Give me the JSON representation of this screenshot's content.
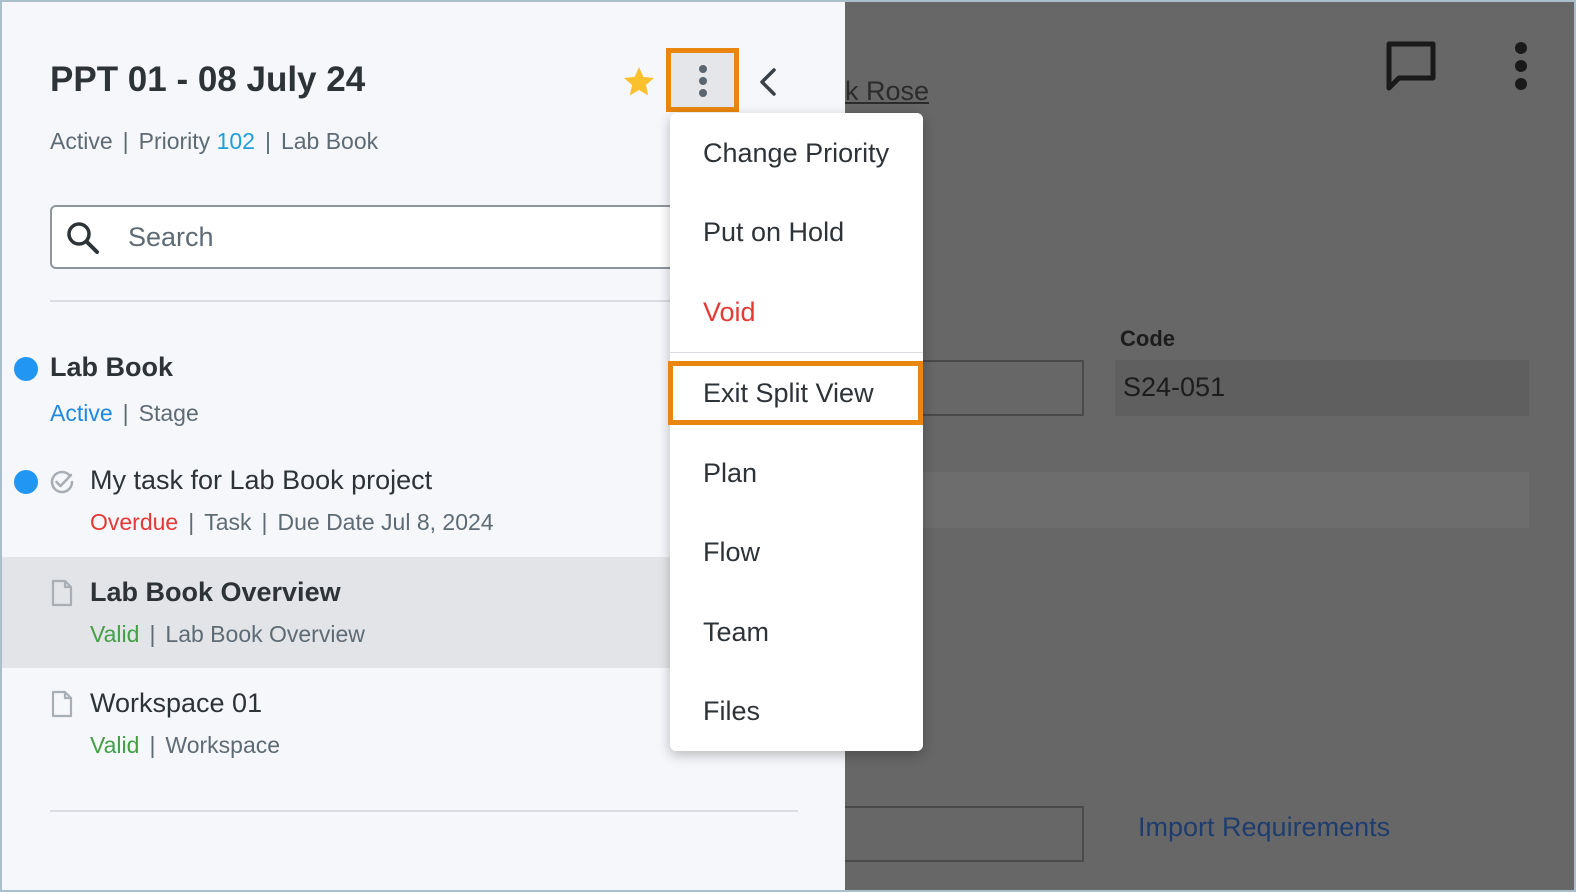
{
  "header": {
    "title": "PPT 01 - 08 July 24",
    "status": "Active",
    "priority_label": "Priority",
    "priority_value": "102",
    "type": "Lab Book"
  },
  "search": {
    "placeholder": "Search"
  },
  "items": [
    {
      "title": "Lab Book",
      "status": "Active",
      "kind": "Stage",
      "status_color": "#1e88e5"
    },
    {
      "title": "My task for Lab Book project",
      "status": "Overdue",
      "kind": "Task",
      "due": "Due Date Jul 8, 2024",
      "status_color": "#e53935"
    },
    {
      "title": "Lab Book Overview",
      "status": "Valid",
      "kind": "Lab Book Overview",
      "status_color": "#43a047"
    },
    {
      "title": "Workspace 01",
      "status": "Valid",
      "kind": "Workspace",
      "status_color": "#43a047"
    }
  ],
  "menu": {
    "items": [
      "Change Priority",
      "Put on Hold",
      "Void",
      "Exit Split View",
      "Plan",
      "Flow",
      "Team",
      "Files"
    ]
  },
  "right": {
    "link_text": "k Rose",
    "code_label": "Code",
    "code_value": "S24-051",
    "import_label": "Import Requirements"
  },
  "colors": {
    "accent": "#1e9fd6",
    "highlight": "#e8860f",
    "star": "#fbc02d",
    "danger": "#e53935",
    "success": "#43a047",
    "dot": "#2196f3"
  },
  "icons": {
    "star": "star-icon",
    "more": "more-vertical-icon",
    "collapse": "chevron-left-icon",
    "search": "search-icon",
    "chat": "chat-icon",
    "document": "document-icon",
    "task": "check-circle-icon"
  }
}
